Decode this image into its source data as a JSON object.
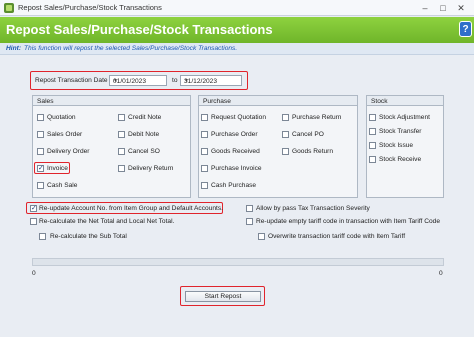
{
  "window": {
    "title": "Repost Sales/Purchase/Stock Transactions",
    "minimize": "–",
    "maximize": "□",
    "close": "✕"
  },
  "banner": {
    "heading": "Repost Sales/Purchase/Stock Transactions",
    "help_icon": "?"
  },
  "hint": {
    "label": "Hint:",
    "text": "This function will repost the selected Sales/Purchase/Stock Transactions."
  },
  "date_range": {
    "label": "Repost Transaction Date",
    "from": "01/01/2023",
    "to_label": "to",
    "to": "31/12/2023"
  },
  "sales": {
    "header": "Sales",
    "items": [
      {
        "label": "Quotation",
        "checked": false
      },
      {
        "label": "Credit Note",
        "checked": false
      },
      {
        "label": "Sales Order",
        "checked": false
      },
      {
        "label": "Debit Note",
        "checked": false
      },
      {
        "label": "Delivery Order",
        "checked": false
      },
      {
        "label": "Cancel SO",
        "checked": false
      },
      {
        "label": "Invoice",
        "checked": true
      },
      {
        "label": "Delivery Return",
        "checked": false
      },
      {
        "label": "Cash Sale",
        "checked": false
      }
    ]
  },
  "purchase": {
    "header": "Purchase",
    "items": [
      {
        "label": "Request Quotation",
        "checked": false
      },
      {
        "label": "Purchase Return",
        "checked": false
      },
      {
        "label": "Purchase Order",
        "checked": false
      },
      {
        "label": "Cancel PO",
        "checked": false
      },
      {
        "label": "Goods Received",
        "checked": false
      },
      {
        "label": "Goods Return",
        "checked": false
      },
      {
        "label": "Purchase Invoice",
        "checked": false
      },
      {
        "label": "Cash Purchase",
        "checked": false
      }
    ]
  },
  "stock": {
    "header": "Stock",
    "items": [
      {
        "label": "Stock Adjustment",
        "checked": false
      },
      {
        "label": "Stock Transfer",
        "checked": false
      },
      {
        "label": "Stock Issue",
        "checked": false
      },
      {
        "label": "Stock Receive",
        "checked": false
      }
    ]
  },
  "options": {
    "reupdate_account": {
      "label": "Re-update Account No. from Item Group and Default Accounts.",
      "checked": true
    },
    "recalc_net": {
      "label": "Re-calculate the Net Total and Local Net Total.",
      "checked": false
    },
    "recalc_sub": {
      "label": "Re-calculate the Sub Total",
      "checked": false
    },
    "bypass_tax": {
      "label": "Allow by pass Tax Transaction Severity",
      "checked": false
    },
    "reupdate_tariff": {
      "label": "Re-update empty tariff code in transaction with Item Tariff Code",
      "checked": false
    },
    "overwrite_tariff": {
      "label": "Overwrite transaction tariff code with Item Tariff",
      "checked": false
    }
  },
  "progress": {
    "value": 0,
    "left_label": "0",
    "right_label": "0"
  },
  "start_button": {
    "label": "Start Repost"
  },
  "colors": {
    "banner": "#7cc234",
    "highlight": "#e0242c",
    "hint_text": "#1a56b0"
  }
}
